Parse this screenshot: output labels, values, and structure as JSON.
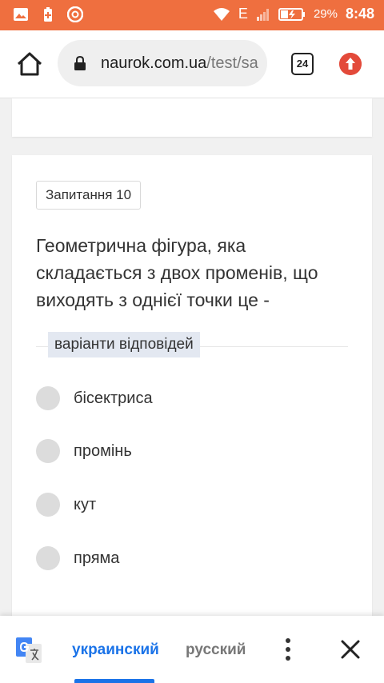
{
  "status_bar": {
    "battery_percent": "29%",
    "time": "8:48",
    "network": "E"
  },
  "browser": {
    "url_host": "naurok.com.ua",
    "url_path": "/test/sa",
    "tab_count": "24"
  },
  "question": {
    "badge": "Запитання 10",
    "text": "Геометрична фігура, яка складається з двох променів, що виходять з однієї точки це -",
    "answers_label": "варіанти відповідей",
    "options": [
      {
        "label": "бісектриса"
      },
      {
        "label": "промінь"
      },
      {
        "label": "кут"
      },
      {
        "label": "пряма"
      }
    ]
  },
  "translate_bar": {
    "lang_active": "украинский",
    "lang_other": "русский"
  }
}
